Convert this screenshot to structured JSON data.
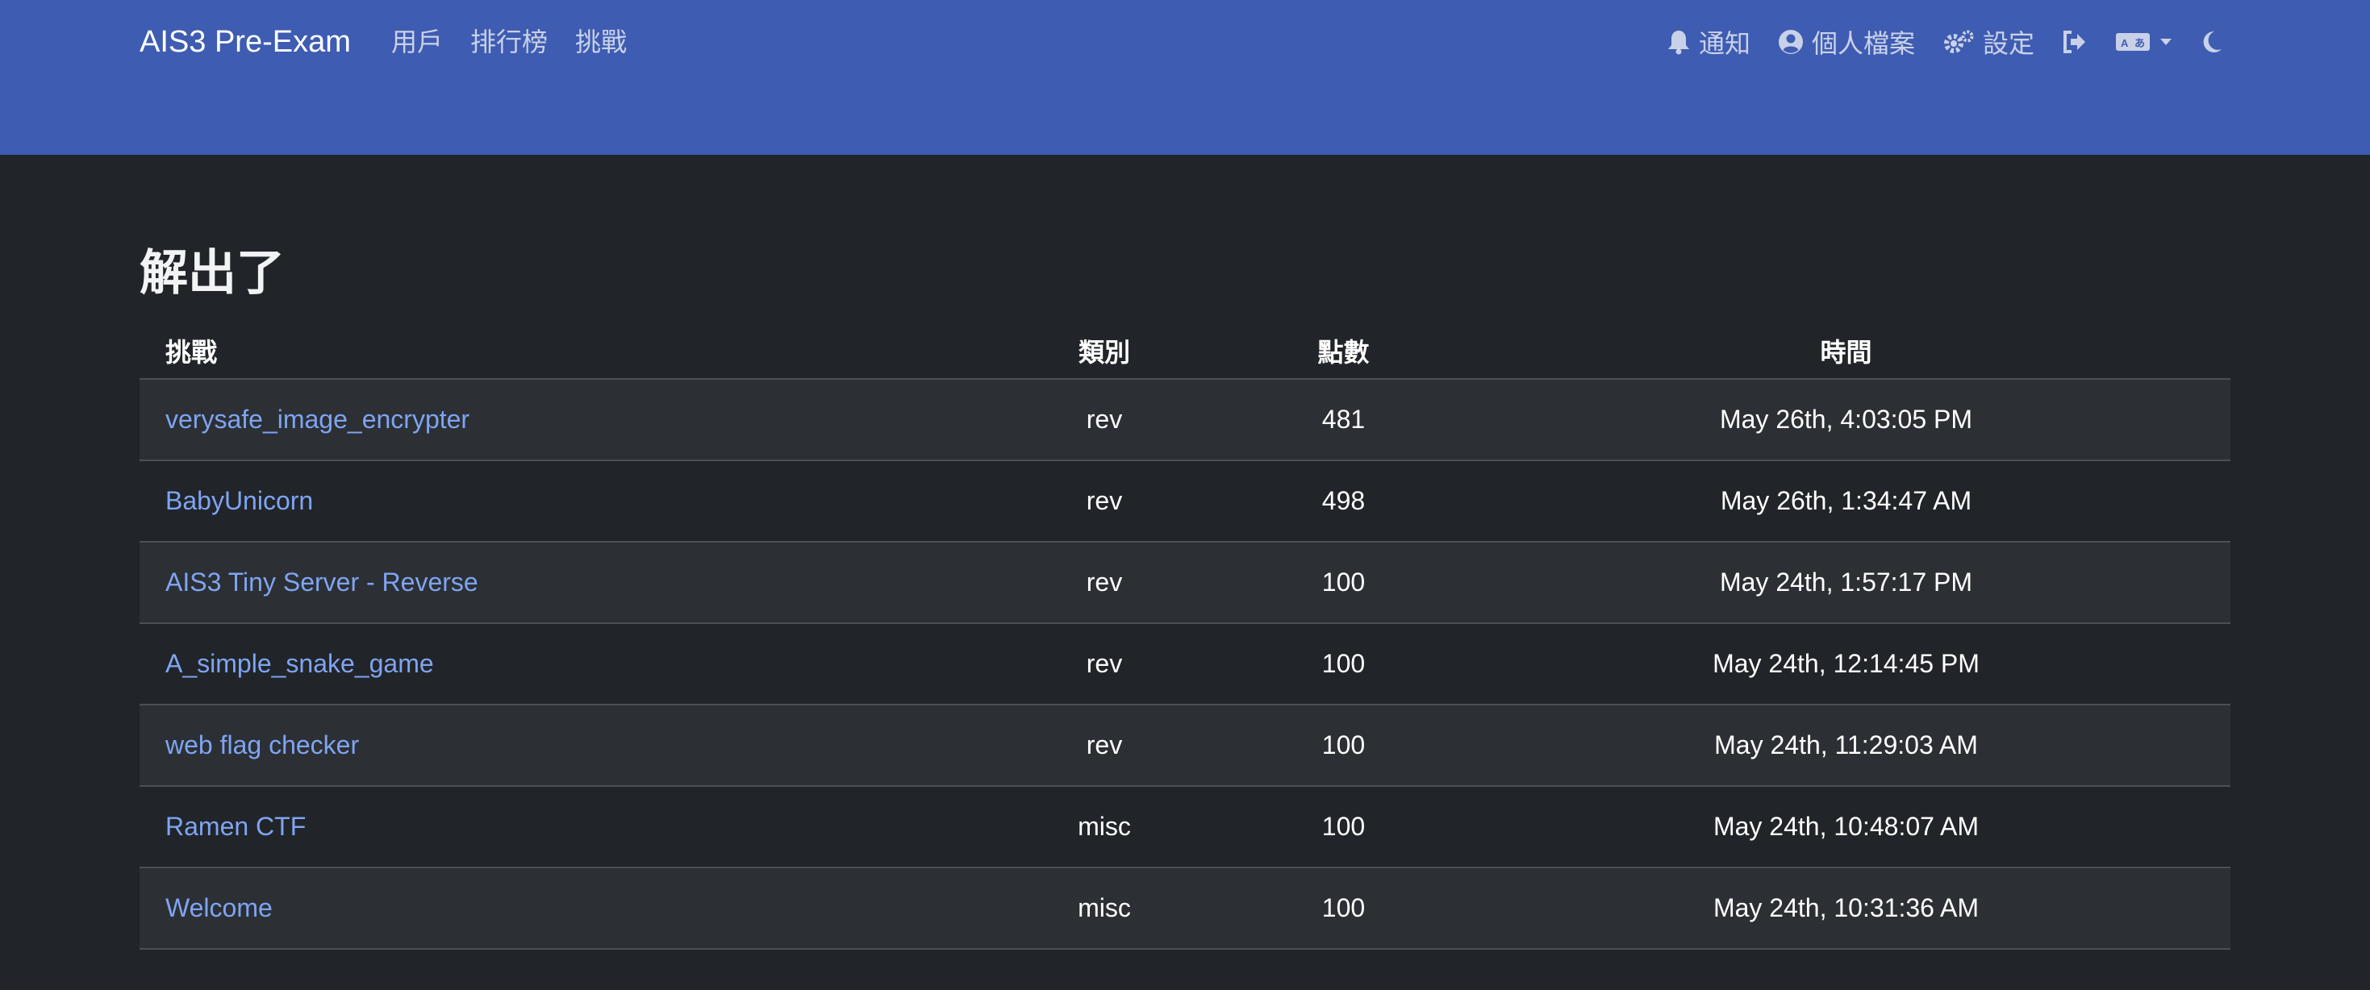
{
  "navbar": {
    "brand": "AIS3 Pre-Exam",
    "left_links": [
      "用戶",
      "排行榜",
      "挑戰"
    ],
    "notifications_label": "通知",
    "profile_label": "個人檔案",
    "settings_label": "設定",
    "icons": [
      "bell-icon",
      "user-circle-icon",
      "gears-icon",
      "logout-icon",
      "language-icon",
      "moon-icon"
    ]
  },
  "page": {
    "title": "解出了"
  },
  "table": {
    "headers": {
      "challenge": "挑戰",
      "category": "類別",
      "points": "點數",
      "time": "時間"
    },
    "rows": [
      {
        "name": "verysafe_image_encrypter",
        "category": "rev",
        "points": "481",
        "time": "May 26th, 4:03:05 PM"
      },
      {
        "name": "BabyUnicorn",
        "category": "rev",
        "points": "498",
        "time": "May 26th, 1:34:47 AM"
      },
      {
        "name": "AIS3 Tiny Server - Reverse",
        "category": "rev",
        "points": "100",
        "time": "May 24th, 1:57:17 PM"
      },
      {
        "name": "A_simple_snake_game",
        "category": "rev",
        "points": "100",
        "time": "May 24th, 12:14:45 PM"
      },
      {
        "name": "web flag checker",
        "category": "rev",
        "points": "100",
        "time": "May 24th, 11:29:03 AM"
      },
      {
        "name": "Ramen CTF",
        "category": "misc",
        "points": "100",
        "time": "May 24th, 10:48:07 AM"
      },
      {
        "name": "Welcome",
        "category": "misc",
        "points": "100",
        "time": "May 24th, 10:31:36 AM"
      }
    ]
  },
  "colors": {
    "navbar_bg": "#3e5cb1",
    "page_bg": "#212529",
    "link": "#7fa4f2",
    "row_stripe": "#2c3034"
  }
}
